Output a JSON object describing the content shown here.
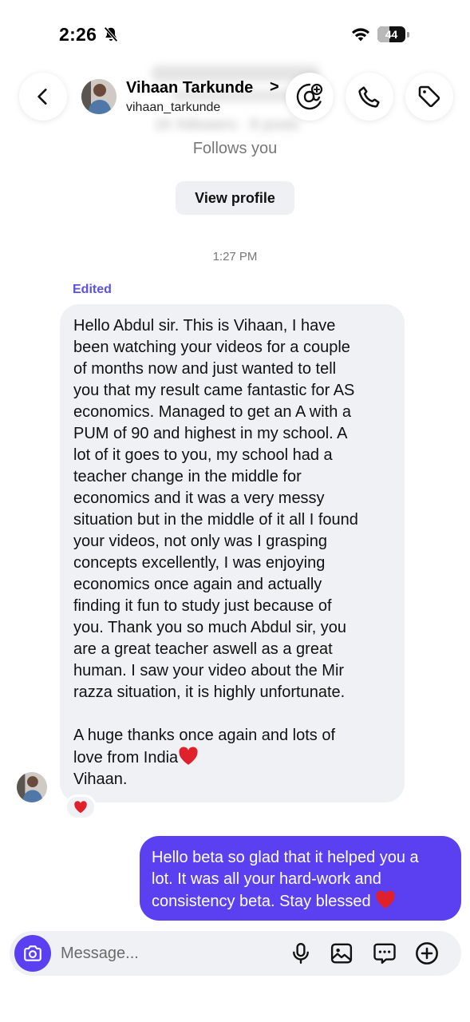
{
  "status_bar": {
    "time": "2:26",
    "battery": "44",
    "battery_fraction": 0.44
  },
  "header": {
    "name": "Vihaan Tarkunde",
    "chevron": ">",
    "username": "vihaan_tarkunde",
    "blurred_stats": "1K followers · 8 posts"
  },
  "profile": {
    "follows_you": "Follows you",
    "view_profile": "View profile"
  },
  "thread": {
    "timestamp": "1:27 PM",
    "edited_label": "Edited",
    "incoming_lines": [
      "Hello Abdul sir. This is Vihaan, I have",
      "been watching your videos for a couple",
      "of months now and just wanted to tell",
      "you that my result came fantastic for AS",
      "economics. Managed to get an A with a",
      "PUM of 90 and highest in my school. A",
      "lot of it goes to you, my school had a",
      "teacher change in the middle for",
      "economics and it was a very messy",
      "situation but in the middle of it all I found",
      "your videos, not only was I grasping",
      "concepts excellently, I was enjoying",
      "economics once again and actually",
      "finding it fun to study just because of",
      "you. Thank you so much Abdul sir, you",
      "are a great teacher aswell as a great",
      "human. I saw your video about the Mir",
      "razza situation, it is highly unfortunate."
    ],
    "incoming_closing": "A huge thanks once again and lots of",
    "incoming_love": "love from India",
    "incoming_signature": "Vihaan.",
    "reaction": "heart",
    "outgoing_lines": [
      "Hello beta so glad that it helped you a",
      "lot. It was all your hard-work and",
      "consistency beta. Stay blessed"
    ]
  },
  "composer": {
    "placeholder": "Message..."
  },
  "colors": {
    "accent": "#5a40f0",
    "edited": "#5b51e0",
    "incoming_bg": "#eff1f4",
    "heart": "#e0212c"
  },
  "icons": [
    "chevron-left-icon",
    "threads-add-icon",
    "phone-icon",
    "tag-icon",
    "camera-icon",
    "mic-icon",
    "gallery-icon",
    "sticker-icon",
    "plus-icon",
    "heart-icon",
    "bell-slash-icon",
    "wifi-icon",
    "battery-icon"
  ]
}
